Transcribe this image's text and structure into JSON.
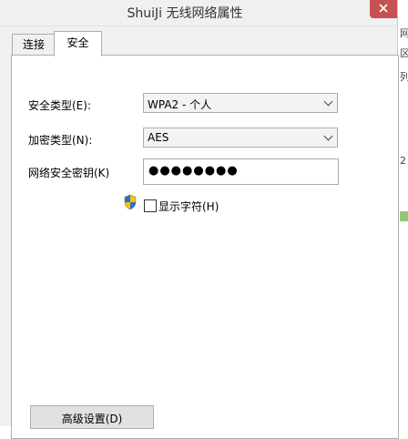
{
  "window": {
    "title": "ShuiJi 无线网络属性"
  },
  "tabs": [
    {
      "label": "连接"
    },
    {
      "label": "安全"
    }
  ],
  "security": {
    "type_label": "安全类型(E):",
    "type_value": "WPA2 - 个人",
    "encryption_label": "加密类型(N):",
    "encryption_value": "AES",
    "key_label": "网络安全密钥(K)",
    "key_value": "●●●●●●●●",
    "show_chars_label": "显示字符(H)",
    "show_chars_checked": false
  },
  "advanced_button": {
    "label": "高级设置(D)"
  },
  "background_window": {
    "chars": [
      "网",
      "区",
      "列",
      "2"
    ]
  },
  "colors": {
    "close_button": "#c75050",
    "frame": "#f0f0f0",
    "panel": "#ffffff"
  }
}
